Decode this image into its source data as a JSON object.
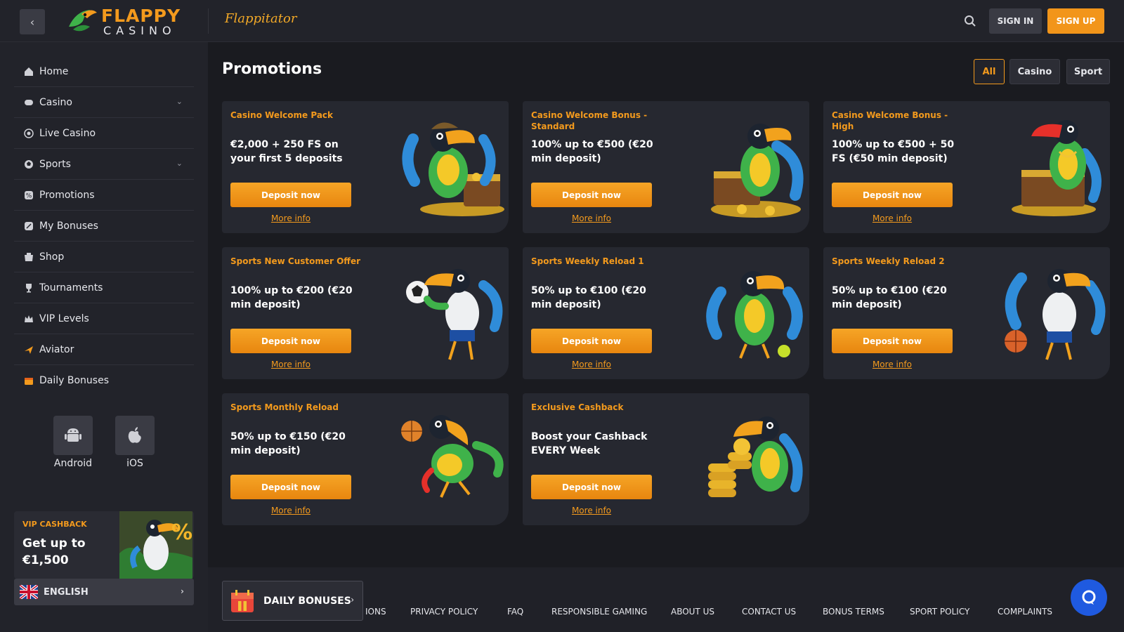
{
  "header": {
    "logo_top": "FLAPPY",
    "logo_bottom": "CASINO",
    "flappitator": "Flappitator",
    "sign_in": "SIGN IN",
    "sign_up": "SIGN UP"
  },
  "sidebar": {
    "items": [
      {
        "label": "Home",
        "icon": "home-icon"
      },
      {
        "label": "Casino",
        "icon": "gamepad-icon",
        "expandable": true
      },
      {
        "label": "Live Casino",
        "icon": "live-icon"
      },
      {
        "label": "Sports",
        "icon": "sports-icon",
        "expandable": true
      },
      {
        "label": "Promotions",
        "icon": "promotions-icon"
      },
      {
        "label": "My Bonuses",
        "icon": "bonuses-icon"
      },
      {
        "label": "Shop",
        "icon": "shop-icon"
      },
      {
        "label": "Tournaments",
        "icon": "trophy-icon"
      },
      {
        "label": "VIP Levels",
        "icon": "crown-icon"
      },
      {
        "label": "Aviator",
        "icon": "plane-icon"
      },
      {
        "label": "Daily Bonuses",
        "icon": "calendar-icon"
      }
    ],
    "apps": [
      {
        "label": "Android",
        "icon": "android-icon"
      },
      {
        "label": "iOS",
        "icon": "apple-icon"
      }
    ],
    "vip": {
      "title": "VIP CASHBACK",
      "text": "Get up to €1,500"
    },
    "language": "ENGLISH"
  },
  "main": {
    "title": "Promotions",
    "filters": [
      {
        "label": "All",
        "active": true
      },
      {
        "label": "Casino",
        "active": false
      },
      {
        "label": "Sport",
        "active": false
      }
    ],
    "deposit_label": "Deposit now",
    "more_info_label": "More info",
    "promos": [
      {
        "title": "Casino Welcome Pack",
        "desc": "€2,000 + 250 FS on your first 5 deposits"
      },
      {
        "title": "Casino Welcome Bonus - Standard",
        "desc": "100% up to €500 (€20 min deposit)"
      },
      {
        "title": "Casino Welcome Bonus - High",
        "desc": "100% up to €500 + 50 FS (€50 min deposit)"
      },
      {
        "title": "Sports New Customer Offer",
        "desc": "100% up to €200 (€20 min deposit)"
      },
      {
        "title": "Sports Weekly Reload 1",
        "desc": "50% up to €100 (€20 min deposit)"
      },
      {
        "title": "Sports Weekly Reload 2",
        "desc": "50% up to €100 (€20 min deposit)"
      },
      {
        "title": "Sports Monthly Reload",
        "desc": "50% up to €150 (€20 min deposit)"
      },
      {
        "title": "Exclusive Cashback",
        "desc": "Boost your Cashback EVERY Week"
      }
    ]
  },
  "footer": {
    "daily_bonuses": "DAILY BONUSES",
    "partial_link": "IONS",
    "links": [
      "PRIVACY POLICY",
      "FAQ",
      "RESPONSIBLE GAMING",
      "ABOUT US",
      "CONTACT US",
      "BONUS TERMS",
      "SPORT POLICY",
      "COMPLAINTS"
    ]
  },
  "colors": {
    "accent": "#f39a1d",
    "background": "#1a1b20",
    "panel": "#22232a",
    "card": "#262830",
    "chat": "#1f5ae0"
  }
}
